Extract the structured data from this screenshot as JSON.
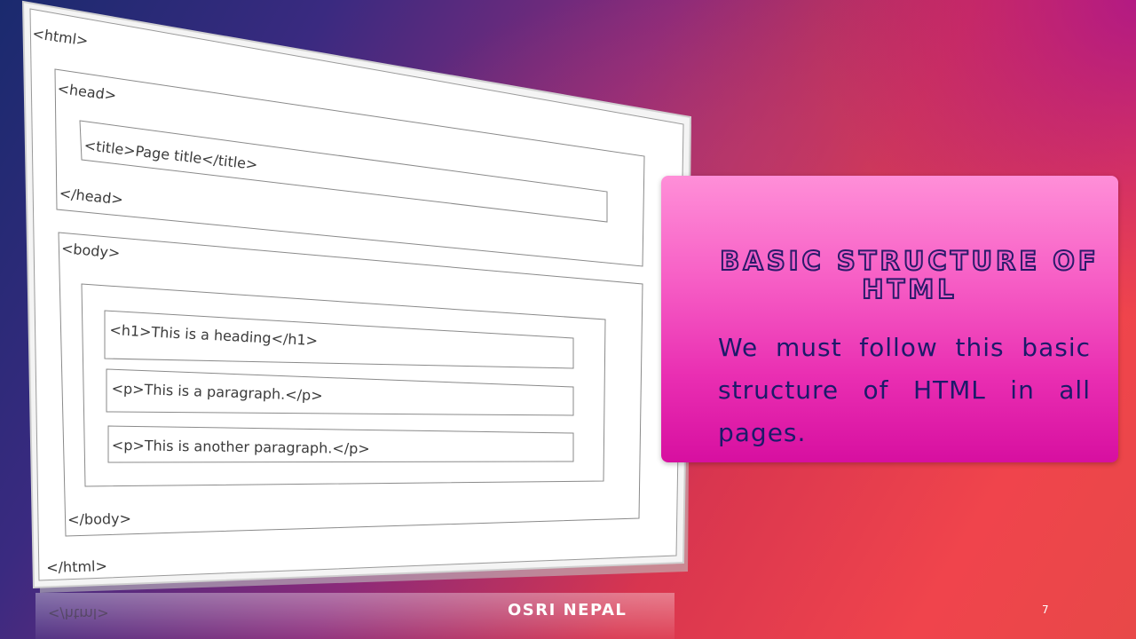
{
  "diagram": {
    "lines": {
      "html_open": "<html>",
      "head_open": "<head>",
      "title_line": "<title>Page title</title>",
      "head_close": "</head>",
      "body_open": "<body>",
      "h1_line": "<h1>This is a heading</h1>",
      "p1_line": "<p>This is a paragraph.</p>",
      "p2_line": "<p>This is another paragraph.</p>",
      "body_close": "</body>",
      "html_close": "</html>"
    },
    "reflection_text": "</html>"
  },
  "infobox": {
    "title": "Basic structure of HTML",
    "body": "We must follow this basic structure of HTML in all pages."
  },
  "footer": {
    "brand": "OSRI NEPAL",
    "page_number": "7"
  }
}
